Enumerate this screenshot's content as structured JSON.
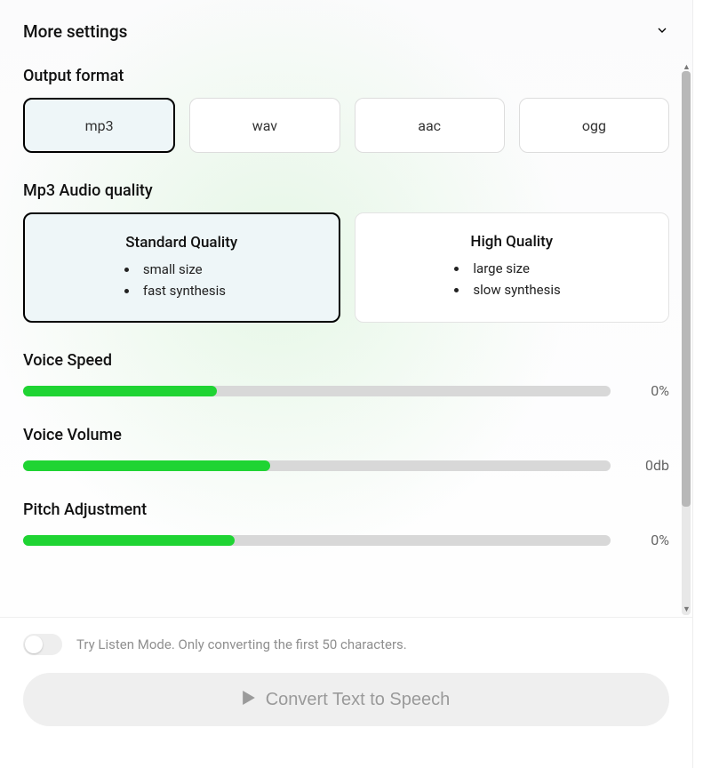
{
  "header": {
    "title": "More settings"
  },
  "outputFormat": {
    "label": "Output format",
    "options": [
      "mp3",
      "wav",
      "aac",
      "ogg"
    ],
    "selected": "mp3"
  },
  "audioQuality": {
    "label": "Mp3 Audio quality",
    "cards": [
      {
        "title": "Standard Quality",
        "points": [
          "small size",
          "fast synthesis"
        ],
        "selected": true
      },
      {
        "title": "High Quality",
        "points": [
          "large size",
          "slow synthesis"
        ],
        "selected": false
      }
    ]
  },
  "sliders": {
    "speed": {
      "label": "Voice Speed",
      "value": "0%",
      "fillPercent": 33
    },
    "volume": {
      "label": "Voice Volume",
      "value": "0db",
      "fillPercent": 42
    },
    "pitch": {
      "label": "Pitch Adjustment",
      "value": "0%",
      "fillPercent": 36
    }
  },
  "listenMode": {
    "label": "Try Listen Mode. Only converting the first 50 characters.",
    "enabled": false
  },
  "convertButton": {
    "label": "Convert Text to Speech"
  }
}
